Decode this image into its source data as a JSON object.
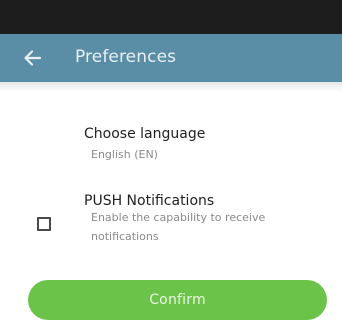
{
  "app_bar": {
    "title": "Preferences",
    "back_icon": "arrow-left-icon",
    "color": "#5a8da6"
  },
  "language": {
    "title": "Choose language",
    "value": "English (EN)"
  },
  "push": {
    "title": "PUSH Notifications",
    "description": "Enable the capability to receive notifications",
    "checked": false
  },
  "confirm": {
    "label": "Confirm",
    "color": "#6cc34a"
  }
}
